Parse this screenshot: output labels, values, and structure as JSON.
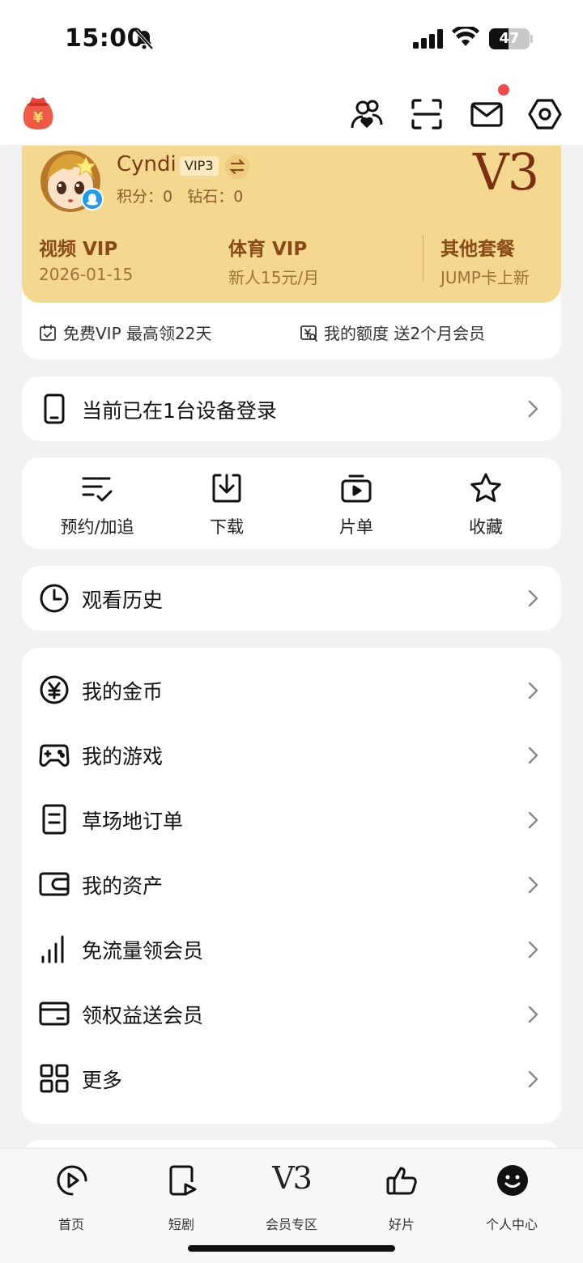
{
  "status_bar": {
    "time": "15:00",
    "battery": "47",
    "battery_level": 0.47
  },
  "member": {
    "username": "Cyndi",
    "vip_badge": "VIP3",
    "points": "积分：0",
    "diamonds": "钻石：0",
    "level": "V3",
    "plans": [
      {
        "title": "视频 VIP",
        "sub": "2026-01-15"
      },
      {
        "title": "体育 VIP",
        "sub": "新人15元/月"
      },
      {
        "title": "其他套餐",
        "sub": "JUMP卡上新"
      }
    ],
    "promos": [
      {
        "label": "免费VIP 最高领22天",
        "icon": "calendar-check-icon"
      },
      {
        "label": "我的额度 送2个月会员",
        "icon": "coupon-icon"
      }
    ]
  },
  "devices": {
    "label": "当前已在1台设备登录"
  },
  "quick_actions": [
    {
      "label": "预约/加追",
      "icon": "list-check-icon"
    },
    {
      "label": "下载",
      "icon": "download-icon"
    },
    {
      "label": "片单",
      "icon": "playlist-icon"
    },
    {
      "label": "收藏",
      "icon": "star-icon"
    }
  ],
  "history": {
    "label": "观看历史"
  },
  "menu": [
    {
      "label": "我的金币",
      "icon": "yen-coin-icon"
    },
    {
      "label": "我的游戏",
      "icon": "gamepad-icon"
    },
    {
      "label": "草场地订单",
      "icon": "document-icon"
    },
    {
      "label": "我的资产",
      "icon": "wallet-icon"
    },
    {
      "label": "免流量领会员",
      "icon": "signal-bars-icon"
    },
    {
      "label": "领权益送会员",
      "icon": "card-icon"
    },
    {
      "label": "更多",
      "icon": "grid-icon"
    }
  ],
  "tabs": [
    {
      "label": "首页",
      "icon": "play-circle-icon"
    },
    {
      "label": "短剧",
      "icon": "short-video-icon"
    },
    {
      "label": "会员专区",
      "icon": "v3-logo-icon",
      "glyph": "V3"
    },
    {
      "label": "好片",
      "icon": "thumbs-up-icon"
    },
    {
      "label": "个人中心",
      "icon": "smile-face-icon",
      "active": true
    }
  ],
  "colors": {
    "card_gold": "#f4d890",
    "accent_brown": "#7a2f10",
    "notification_red": "#f04a4a"
  }
}
